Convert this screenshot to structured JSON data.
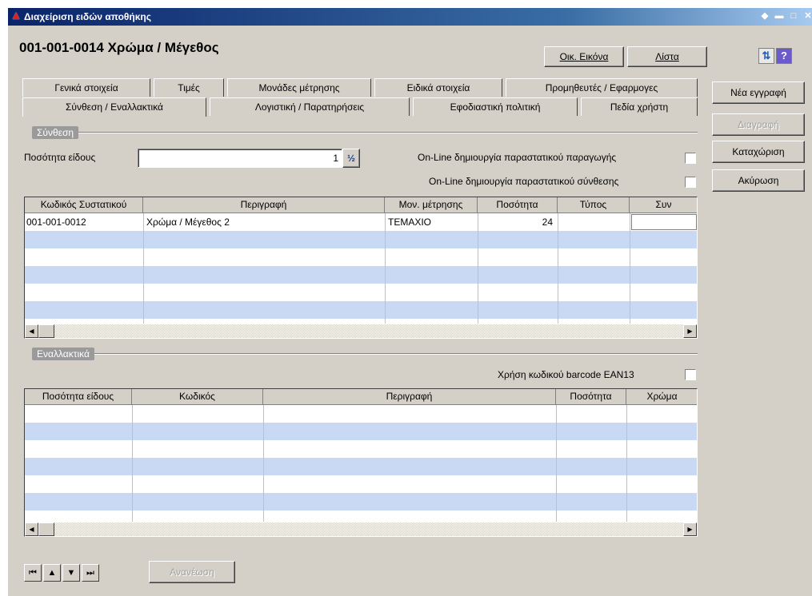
{
  "window": {
    "title": "Διαχείριση ειδών αποθήκης",
    "controls": [
      "◆",
      "▬",
      "□",
      "✕"
    ]
  },
  "header": {
    "record_title": "001-001-0014 Χρώμα / Μέγεθος",
    "image_button_label": "Οικ. Εικόνα",
    "list_button_label": "Λίστα"
  },
  "side_buttons": {
    "new": "Νέα εγγραφή",
    "delete": "Διαγραφή",
    "save": "Καταχώριση",
    "cancel": "Ακύρωση"
  },
  "tabs": {
    "row1": [
      "Γενικά στοιχεία",
      "Τιμές",
      "Μονάδες μέτρησης",
      "Ειδικά στοιχεία",
      "Προμηθευτές / Εφαρμογες"
    ],
    "row2": [
      "Σύνθεση / Εναλλακτικά",
      "Λογιστική / Παρατηρήσεις",
      "Εφοδιαστική πολιτική",
      "Πεδία χρήστη"
    ],
    "active": "Σύνθεση / Εναλλακτικά"
  },
  "composition": {
    "group_label": "Σύνθεση",
    "qty_label": "Ποσότητα είδους",
    "qty_value": "1",
    "fraction_icon": "½",
    "online_production_label": "On-Line δημιουργία παραστατικού παραγωγής",
    "online_composition_label": "On-Line δημιουργία παραστατικού σύνθεσης",
    "columns": [
      "Κωδικός Συστατικού",
      "Περιγραφή",
      "Μον. μέτρησης",
      "Ποσότητα",
      "Τύπος",
      "Συν"
    ],
    "rows": [
      [
        "001-001-0012",
        "Χρώμα / Μέγεθος 2",
        "ΤΕΜΑΧΙΟ",
        "24",
        "",
        ""
      ]
    ]
  },
  "alternatives": {
    "group_label": "Εναλλακτικά",
    "barcode_label": "Χρήση κωδικού barcode EAN13",
    "columns": [
      "Ποσότητα είδους",
      "Κωδικός",
      "Περιγραφή",
      "Ποσότητα",
      "Χρώμα"
    ]
  },
  "navigation": {
    "first": "⏮",
    "prev": "▲",
    "next": "▼",
    "last": "⏭",
    "refresh_label": "Ανανέωση"
  }
}
